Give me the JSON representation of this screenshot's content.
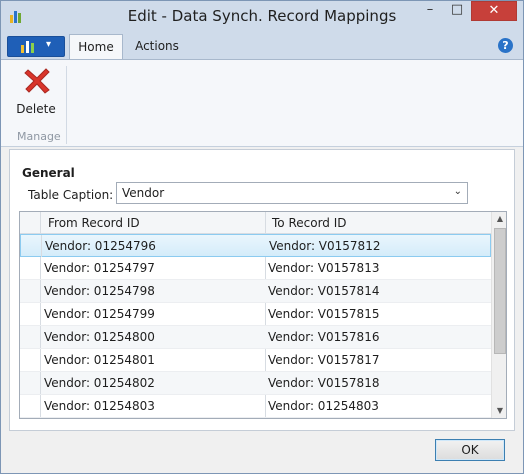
{
  "window": {
    "title": "Edit - Data Synch. Record Mappings",
    "min_glyph": "–",
    "max_glyph": "□",
    "close_glyph": "✕"
  },
  "ribbon": {
    "tabs": [
      {
        "label": "Home",
        "active": true
      },
      {
        "label": "Actions",
        "active": false
      }
    ],
    "app_menu_chevron": "▾",
    "help_glyph": "?",
    "groups": [
      {
        "label": "Manage",
        "actions": [
          {
            "label": "Delete",
            "icon": "delete-x-icon"
          }
        ]
      }
    ]
  },
  "general": {
    "section_title": "General",
    "table_caption_label": "Table Caption:",
    "table_caption_value": "Vendor",
    "combo_chevron": "⌄"
  },
  "grid": {
    "columns": [
      "From Record ID",
      "To Record ID"
    ],
    "rows": [
      {
        "from": "Vendor: 01254796",
        "to": "Vendor: V0157812",
        "selected": true
      },
      {
        "from": "Vendor: 01254797",
        "to": "Vendor: V0157813",
        "selected": false
      },
      {
        "from": "Vendor: 01254798",
        "to": "Vendor: V0157814",
        "selected": false
      },
      {
        "from": "Vendor: 01254799",
        "to": "Vendor: V0157815",
        "selected": false
      },
      {
        "from": "Vendor: 01254800",
        "to": "Vendor: V0157816",
        "selected": false
      },
      {
        "from": "Vendor: 01254801",
        "to": "Vendor: V0157817",
        "selected": false
      },
      {
        "from": "Vendor: 01254802",
        "to": "Vendor: V0157818",
        "selected": false
      },
      {
        "from": "Vendor: 01254803",
        "to": "Vendor: 01254803",
        "selected": false
      }
    ],
    "scroll_up_glyph": "▲",
    "scroll_down_glyph": "▼"
  },
  "footer": {
    "ok_label": "OK"
  },
  "colors": {
    "title_bar": "#cfdbea",
    "close_button": "#c7403a",
    "app_menu": "#1f5fb7",
    "selected_row": "#d4ecfa",
    "delete_icon": "#d9352b"
  }
}
